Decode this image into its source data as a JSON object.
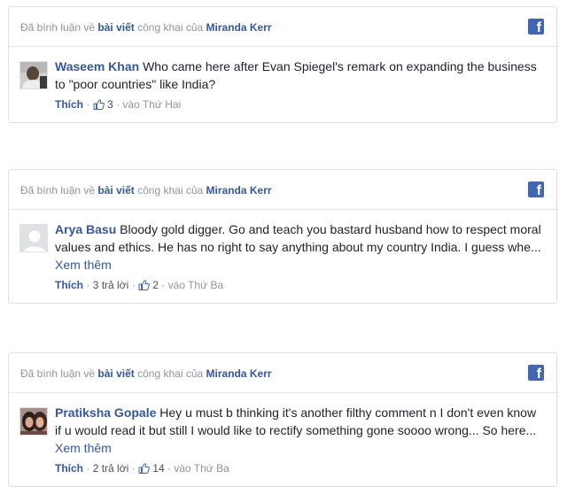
{
  "colors": {
    "link": "#365899",
    "meta": "#90949c",
    "facebook_blue": "#4267b2"
  },
  "comments": [
    {
      "header": {
        "prefix": "Đã bình luận về",
        "post_link": "bài viết",
        "mid": "công khai của",
        "page": "Miranda Kerr"
      },
      "logo": "f",
      "avatar_icon": "user-photo",
      "author": "Waseem Khan",
      "text_lines": [
        "Who came here after Evan Spiegel's remark on expanding the business",
        "to \"poor countries\" like India?"
      ],
      "see_more": "",
      "like_label": "Thích",
      "replies": "",
      "like_count": "3",
      "time": "vào Thứ Hai"
    },
    {
      "header": {
        "prefix": "Đã bình luận về",
        "post_link": "bài viết",
        "mid": "công khai của",
        "page": "Miranda Kerr"
      },
      "logo": "f",
      "avatar_icon": "default-avatar",
      "author": "Arya Basu",
      "text_lines": [
        "Bloody gold digger. Go and teach you bastard husband how to respect moral",
        "values and ethics. He has no right to say anything about my country India. I guess whe..."
      ],
      "see_more": "Xem thêm",
      "like_label": "Thích",
      "replies": "3 trả lời",
      "like_count": "2",
      "time": "vào Thứ Ba"
    },
    {
      "header": {
        "prefix": "Đã bình luận về",
        "post_link": "bài viết",
        "mid": "công khai của",
        "page": "Miranda Kerr"
      },
      "logo": "f",
      "avatar_icon": "user-photo",
      "author": "Pratiksha Gopale",
      "text_lines": [
        "Hey u must b thinking it's another filthy comment n I don't even know",
        "if u would read it but still I would like to rectify something gone soooo wrong... So here..."
      ],
      "see_more": "Xem thêm",
      "like_label": "Thích",
      "replies": "2 trả lời",
      "like_count": "14",
      "time": "vào Thứ Ba"
    }
  ]
}
